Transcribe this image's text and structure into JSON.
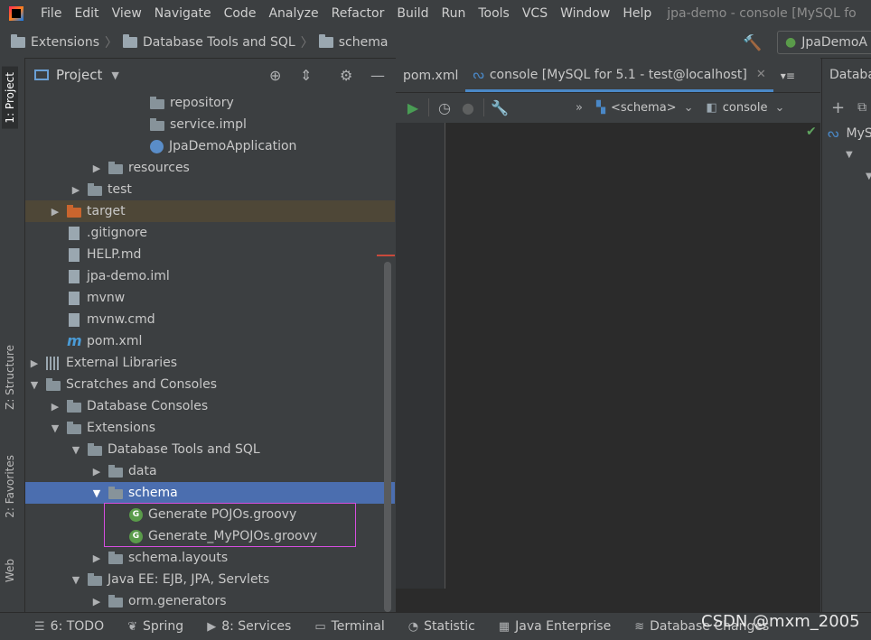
{
  "menubar": {
    "items": [
      "File",
      "Edit",
      "View",
      "Navigate",
      "Code",
      "Analyze",
      "Refactor",
      "Build",
      "Run",
      "Tools",
      "VCS",
      "Window",
      "Help"
    ],
    "window_title": "jpa-demo - console [MySQL fo"
  },
  "breadcrumb": [
    "Extensions",
    "Database Tools and SQL",
    "schema"
  ],
  "run_config": "JpaDemoA",
  "side_tabs": {
    "project": "1: Project",
    "structure": "Z: Structure",
    "favorites": "2: Favorites",
    "web": "Web"
  },
  "project_panel": {
    "title": "Project"
  },
  "tree": [
    {
      "label": "repository",
      "depth": 6,
      "icon": "package-folder",
      "arrow": ""
    },
    {
      "label": "service.impl",
      "depth": 6,
      "icon": "package-folder",
      "arrow": ""
    },
    {
      "label": "JpaDemoApplication",
      "depth": 6,
      "icon": "spring-class",
      "arrow": ""
    },
    {
      "label": "resources",
      "depth": 4,
      "icon": "folder",
      "arrow": "right"
    },
    {
      "label": "test",
      "depth": 3,
      "icon": "folder",
      "arrow": "right"
    },
    {
      "label": "target",
      "depth": 2,
      "icon": "folder-orange",
      "arrow": "right"
    },
    {
      "label": ".gitignore",
      "depth": 2,
      "icon": "file",
      "arrow": ""
    },
    {
      "label": "HELP.md",
      "depth": 2,
      "icon": "file",
      "arrow": ""
    },
    {
      "label": "jpa-demo.iml",
      "depth": 2,
      "icon": "file",
      "arrow": ""
    },
    {
      "label": "mvnw",
      "depth": 2,
      "icon": "file",
      "arrow": ""
    },
    {
      "label": "mvnw.cmd",
      "depth": 2,
      "icon": "file",
      "arrow": ""
    },
    {
      "label": "pom.xml",
      "depth": 2,
      "icon": "maven",
      "arrow": ""
    },
    {
      "label": "External Libraries",
      "depth": 1,
      "icon": "libs",
      "arrow": "right"
    },
    {
      "label": "Scratches and Consoles",
      "depth": 1,
      "icon": "folder",
      "arrow": "down"
    },
    {
      "label": "Database Consoles",
      "depth": 2,
      "icon": "folder",
      "arrow": "right"
    },
    {
      "label": "Extensions",
      "depth": 2,
      "icon": "folder",
      "arrow": "down"
    },
    {
      "label": "Database Tools and SQL",
      "depth": 3,
      "icon": "folder",
      "arrow": "down"
    },
    {
      "label": "data",
      "depth": 4,
      "icon": "folder",
      "arrow": "right"
    },
    {
      "label": "schema",
      "depth": 4,
      "icon": "folder",
      "arrow": "down"
    },
    {
      "label": "Generate POJOs.groovy",
      "depth": 5,
      "icon": "groovy",
      "arrow": ""
    },
    {
      "label": "Generate_MyPOJOs.groovy",
      "depth": 5,
      "icon": "groovy",
      "arrow": ""
    },
    {
      "label": "schema.layouts",
      "depth": 4,
      "icon": "folder",
      "arrow": "right"
    },
    {
      "label": "Java EE: EJB, JPA, Servlets",
      "depth": 3,
      "icon": "folder",
      "arrow": "down"
    },
    {
      "label": "orm.generators",
      "depth": 4,
      "icon": "folder",
      "arrow": "right"
    }
  ],
  "editor_tabs": [
    {
      "label": "pom.xml"
    },
    {
      "label": "console [MySQL for 5.1 - test@localhost]"
    }
  ],
  "editor_toolbar": {
    "schema": "<schema>",
    "console": "console"
  },
  "db_panel": {
    "title": "Databa",
    "root": "MyS"
  },
  "bottom_tabs": [
    {
      "label": "6: TODO",
      "icon": "☰"
    },
    {
      "label": "Spring",
      "icon": "❦"
    },
    {
      "label": "8: Services",
      "icon": "▶"
    },
    {
      "label": "Terminal",
      "icon": "▭"
    },
    {
      "label": "Statistic",
      "icon": "◔"
    },
    {
      "label": "Java Enterprise",
      "icon": "▦"
    },
    {
      "label": "Database Changes",
      "icon": "≋"
    }
  ],
  "watermark": "CSDN @mxm_2005",
  "colors": {
    "selection": "#4b6eaf",
    "highlight_box": "#d64ee0",
    "run_green": "#499c54"
  }
}
